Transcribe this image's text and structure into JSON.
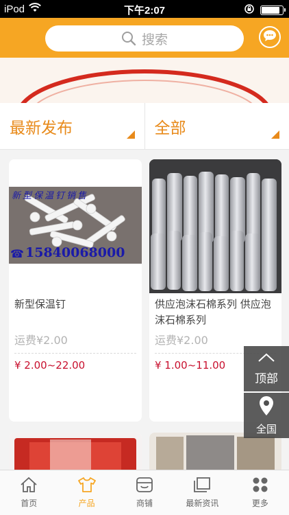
{
  "status_bar": {
    "carrier": "iPod",
    "time": "下午2:07",
    "battery_level": 0.85
  },
  "header": {
    "search_placeholder": "搜索"
  },
  "filters": {
    "sort_label": "最新发布",
    "category_label": "全部"
  },
  "products": [
    {
      "image_text_line1": "新型保温钉销售",
      "image_text_line2": "15840068000",
      "title": "新型保温钉",
      "shipping": "运费¥2.00",
      "price": "¥ 2.00~22.00"
    },
    {
      "title": "供应泡沫石棉系列 供应泡沫石棉系列",
      "shipping": "运费¥2.00",
      "price": "¥ 1.00~11.00"
    }
  ],
  "floating": {
    "top_label": "顶部",
    "all_label": "全国"
  },
  "tabbar": {
    "items": [
      {
        "label": "首页",
        "icon": "home-icon"
      },
      {
        "label": "产品",
        "icon": "shirt-icon",
        "active": true
      },
      {
        "label": "商铺",
        "icon": "shop-icon"
      },
      {
        "label": "最新资讯",
        "icon": "news-icon"
      },
      {
        "label": "更多",
        "icon": "more-icon"
      }
    ]
  },
  "colors": {
    "accent": "#f6a623",
    "price": "#c8102e",
    "filter_text": "#e88a1a"
  }
}
